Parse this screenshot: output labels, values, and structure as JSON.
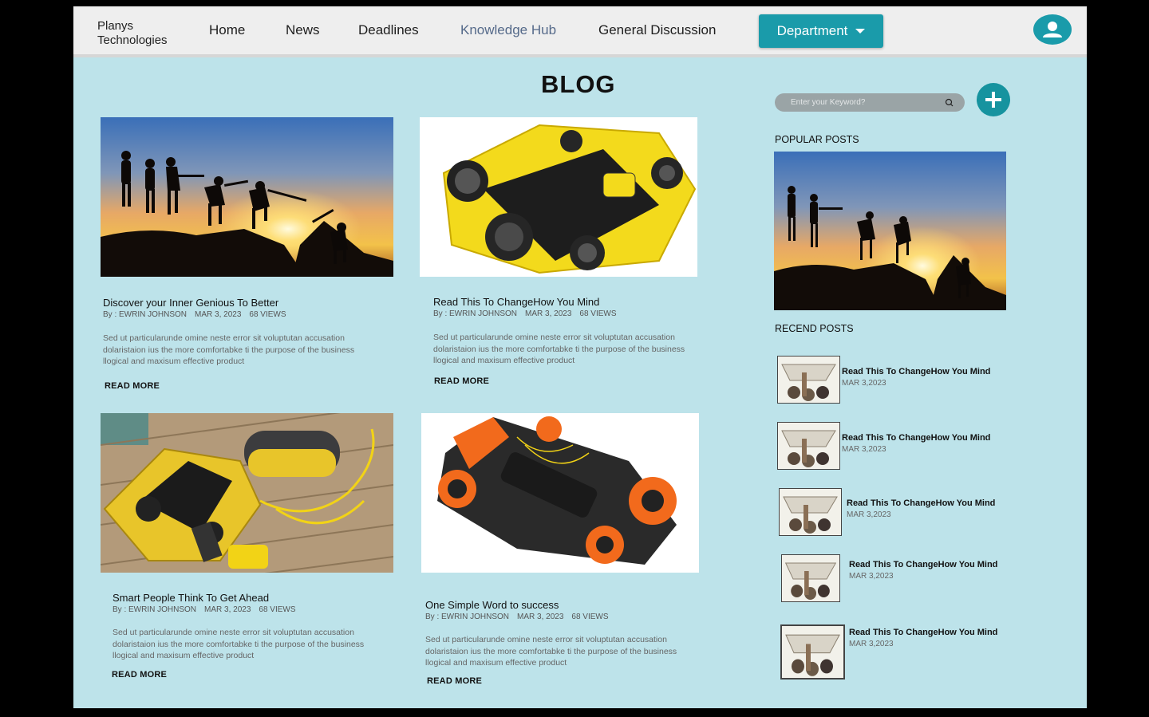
{
  "navbar": {
    "brand": "Planys Technologies",
    "links": [
      "Home",
      "News",
      "Deadlines",
      "Knowledge Hub",
      "General Discussion"
    ],
    "active_link": "Knowledge Hub",
    "department_label": "Department"
  },
  "page_title": "BLOG",
  "posts": [
    {
      "title": "Discover your Inner Genious To Better",
      "author": "By : EWRIN JOHNSON",
      "date": "MAR 3, 2023",
      "views": "68 VIEWS",
      "excerpt": "Sed ut particularunde omine neste error sit voluptutan accusation dolaristaion ius the more comfortabke ti the purpose of the business llogical and maxisum effective product",
      "read_more": "READ MORE",
      "image": "silhouette-climbers-sunset"
    },
    {
      "title": "Read This To ChangeHow You Mind",
      "author": "By : EWRIN JOHNSON",
      "date": "MAR 3, 2023",
      "views": "68 VIEWS",
      "excerpt": "Sed ut particularunde omine neste error sit voluptutan accusation dolaristaion ius the more comfortabke ti the purpose of the business llogical and maxisum effective product",
      "read_more": "READ MORE",
      "image": "yellow-underwater-drone"
    },
    {
      "title": "Smart People Think To Get Ahead",
      "author": "By : EWRIN JOHNSON",
      "date": "MAR 3, 2023",
      "views": "68 VIEWS",
      "excerpt": "Sed ut particularunde omine neste error sit voluptutan accusation dolaristaion ius the more comfortabke ti the purpose of the business llogical and maxisum effective product",
      "read_more": "READ MORE",
      "image": "drone-on-dock-with-tether"
    },
    {
      "title": "One Simple Word to success",
      "author": "By : EWRIN JOHNSON",
      "date": "MAR 3, 2023",
      "views": "68 VIEWS",
      "excerpt": "Sed ut particularunde omine neste error sit voluptutan accusation dolaristaion ius the more comfortabke ti the purpose of the business llogical and maxisum effective product",
      "read_more": "READ MORE",
      "image": "orange-underwater-drone"
    }
  ],
  "sidebar": {
    "search_placeholder": "Enter your Keyword?",
    "popular_heading": "POPULAR POSTS",
    "recent_heading": "RECEND POSTS",
    "recent_posts": [
      {
        "title": "Read This To ChangeHow You Mind",
        "date": "MAR 3,2023"
      },
      {
        "title": "Read This To ChangeHow You Mind",
        "date": "MAR 3,2023"
      },
      {
        "title": "Read This To ChangeHow You Mind",
        "date": "MAR 3,2023"
      },
      {
        "title": "Read This To ChangeHow You Mind",
        "date": "MAR 3,2023"
      },
      {
        "title": "Read This To ChangeHow You Mind",
        "date": "MAR 3,2023"
      }
    ]
  },
  "colors": {
    "accent": "#1a9baa",
    "page_bg": "#bde3ea",
    "nav_bg": "#eeeeee",
    "active_link": "#556a8a"
  }
}
